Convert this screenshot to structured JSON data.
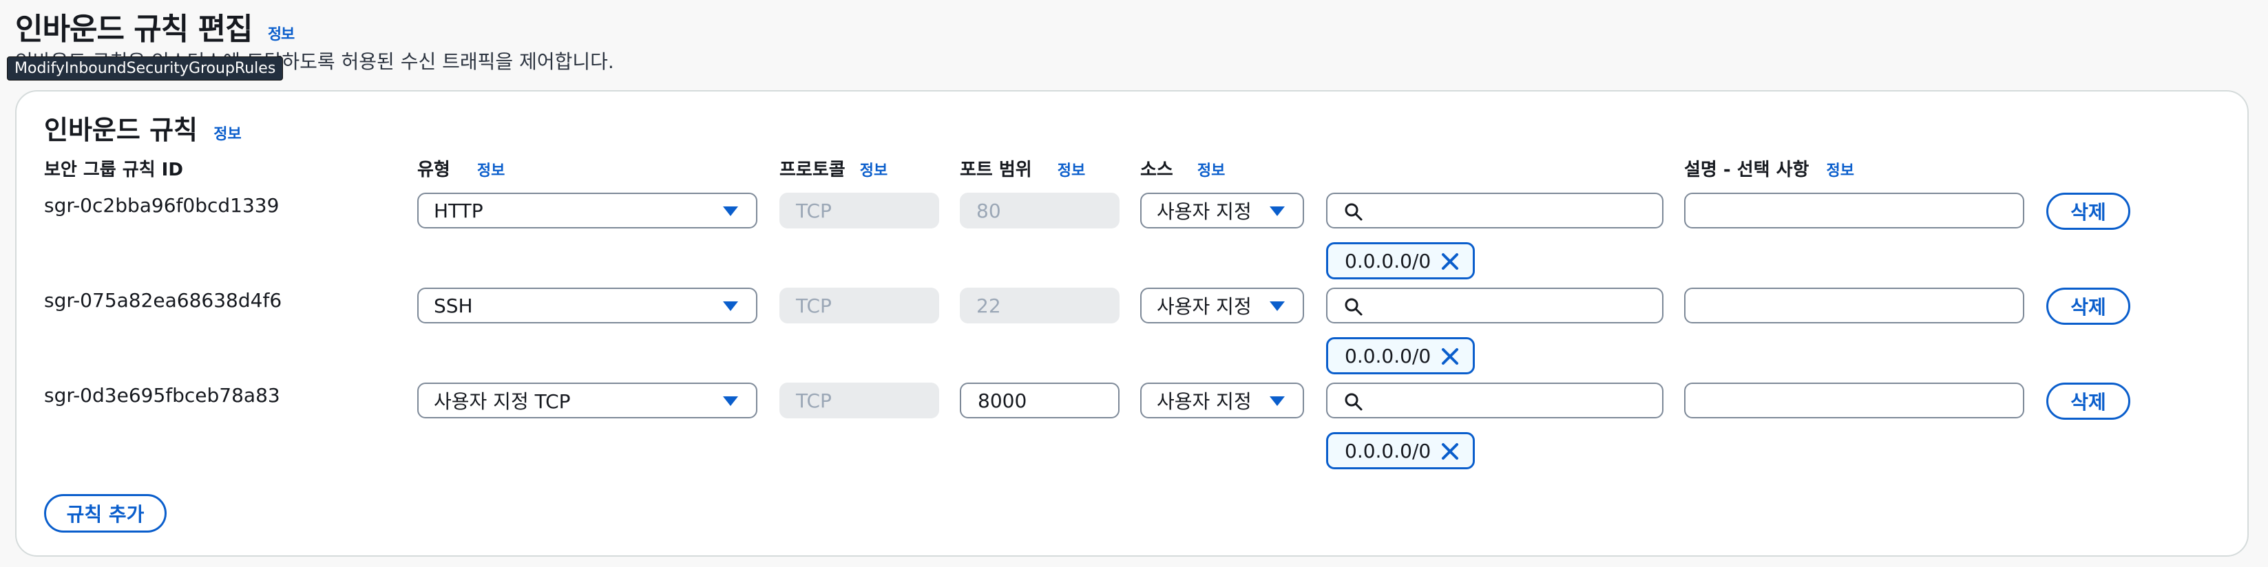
{
  "page": {
    "title": "인바운드 규칙 편집",
    "title_info": "정보",
    "subtitle": "인바운드 규칙은 인스턴스에 도달하도록 허용된 수신 트래픽을 제어합니다.",
    "tooltip": "ModifyInboundSecurityGroupRules"
  },
  "panel": {
    "title": "인바운드 규칙",
    "title_info": "정보",
    "columns": {
      "rule_id": "보안 그룹 규칙 ID",
      "type": "유형",
      "protocol": "프로토콜",
      "port_range": "포트 범위",
      "source": "소스",
      "description": "설명 - 선택 사항",
      "info": "정보"
    },
    "rows": [
      {
        "id": "sgr-0c2bba96f0bcd1339",
        "type": "HTTP",
        "protocol": "TCP",
        "port": "80",
        "port_editable": false,
        "source": "사용자 지정",
        "search_value": "",
        "cidr": "0.0.0.0/0",
        "description": "",
        "delete": "삭제"
      },
      {
        "id": "sgr-075a82ea68638d4f6",
        "type": "SSH",
        "protocol": "TCP",
        "port": "22",
        "port_editable": false,
        "source": "사용자 지정",
        "search_value": "",
        "cidr": "0.0.0.0/0",
        "description": "",
        "delete": "삭제"
      },
      {
        "id": "sgr-0d3e695fbceb78a83",
        "type": "사용자 지정 TCP",
        "protocol": "TCP",
        "port": "8000",
        "port_editable": true,
        "source": "사용자 지정",
        "search_value": "",
        "cidr": "0.0.0.0/0",
        "description": "",
        "delete": "삭제"
      }
    ],
    "add_rule": "규칙 추가"
  },
  "colors": {
    "accent": "#0a5ecc",
    "border": "#7d8998",
    "disabled_bg": "#e9ebed"
  },
  "icons": {
    "search": "search-icon",
    "remove_token": "close-icon",
    "dropdown": "caret-down-icon"
  }
}
